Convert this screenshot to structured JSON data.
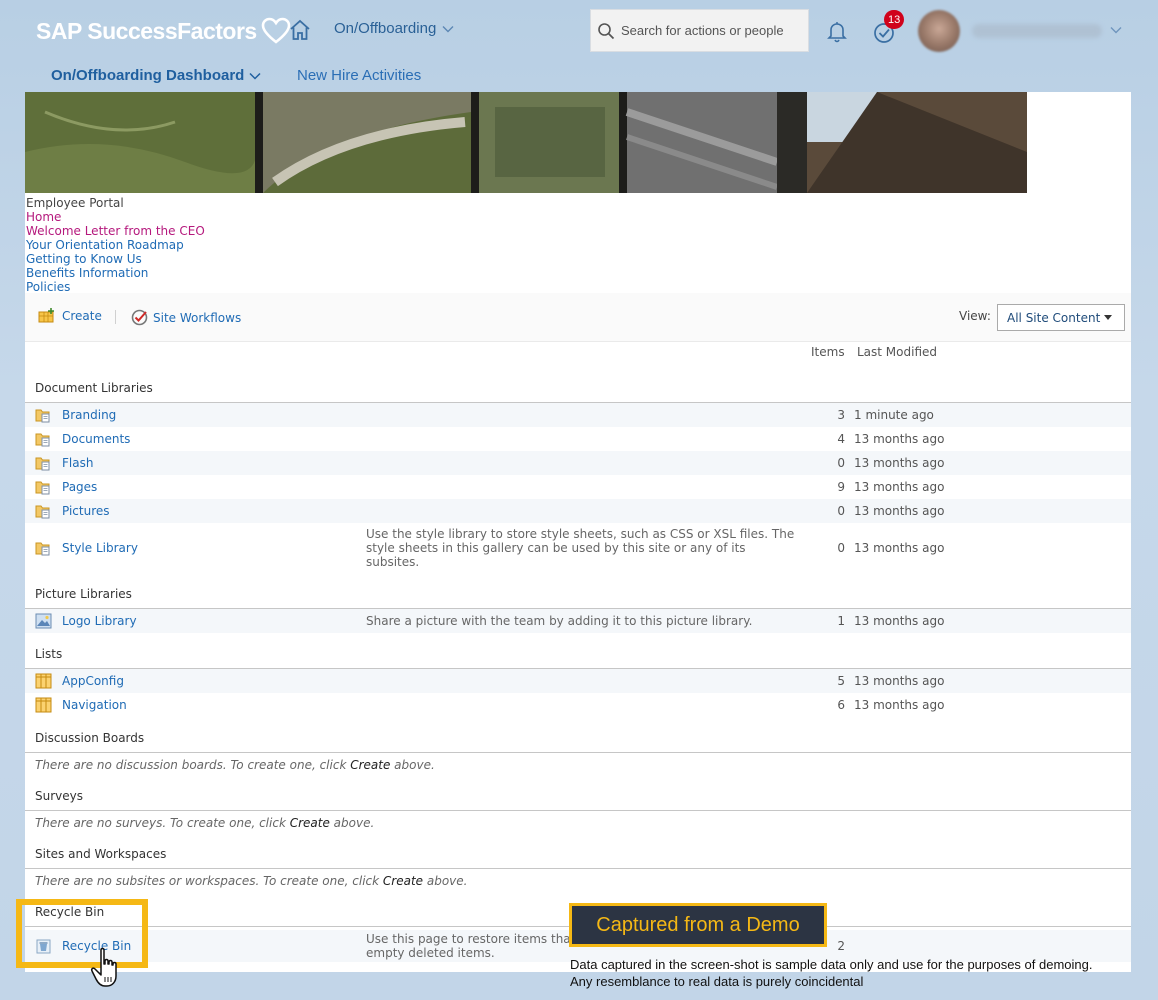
{
  "shell": {
    "brand": "SAP SuccessFactors",
    "module": "On/Offboarding",
    "search_placeholder": "Search for actions or people",
    "todo_badge": "13"
  },
  "subnav": {
    "dashboard": "On/Offboarding Dashboard",
    "new_hire": "New Hire Activities"
  },
  "portal_nav": {
    "heading": "Employee Portal",
    "links": [
      "Home",
      "Welcome Letter from the CEO",
      "Your Orientation Roadmap",
      "Getting to Know Us",
      "Benefits Information",
      "Policies"
    ]
  },
  "toolbar": {
    "create": "Create",
    "site_workflows": "Site Workflows",
    "view_label": "View:",
    "view_value": "All Site Content"
  },
  "columns": {
    "items": "Items",
    "last_modified": "Last Modified"
  },
  "sections": {
    "document_libraries": {
      "title": "Document Libraries",
      "rows": [
        {
          "name": "Branding",
          "desc": "",
          "items": "3",
          "modified": "1 minute ago"
        },
        {
          "name": "Documents",
          "desc": "",
          "items": "4",
          "modified": "13 months ago"
        },
        {
          "name": "Flash",
          "desc": "",
          "items": "0",
          "modified": "13 months ago"
        },
        {
          "name": "Pages",
          "desc": "",
          "items": "9",
          "modified": "13 months ago"
        },
        {
          "name": "Pictures",
          "desc": "",
          "items": "0",
          "modified": "13 months ago"
        },
        {
          "name": "Style Library",
          "desc_lines": [
            "Use the style library to store style sheets, such as CSS or XSL files. The",
            "style sheets in this gallery can be used by this site or any of its",
            "subsites."
          ],
          "items": "0",
          "modified": "13 months ago"
        }
      ]
    },
    "picture_libraries": {
      "title": "Picture Libraries",
      "rows": [
        {
          "name": "Logo Library",
          "desc": "Share a picture with the team by adding it to this picture library.",
          "items": "1",
          "modified": "13 months ago"
        }
      ]
    },
    "lists": {
      "title": "Lists",
      "rows": [
        {
          "name": "AppConfig",
          "items": "5",
          "modified": "13 months ago"
        },
        {
          "name": "Navigation",
          "items": "6",
          "modified": "13 months ago"
        }
      ]
    },
    "discussion_boards": {
      "title": "Discussion Boards",
      "empty_pre": "There are no discussion boards. To create one, click ",
      "empty_link": "Create",
      "empty_post": " above."
    },
    "surveys": {
      "title": "Surveys",
      "empty_pre": "There are no surveys. To create one, click ",
      "empty_link": "Create",
      "empty_post": " above."
    },
    "sites": {
      "title": "Sites and Workspaces",
      "empty_pre": "There are no subsites or workspaces. To create one, click ",
      "empty_link": "Create",
      "empty_post": " above."
    },
    "recycle_bin": {
      "title": "Recycle Bin",
      "name": "Recycle Bin",
      "desc_lines": [
        "Use this page to restore items tha",
        "empty deleted items."
      ],
      "items": "2"
    }
  },
  "overlay": {
    "demo_tag": "Captured from a Demo",
    "note_line1": "Data captured in the screen-shot is sample data only and use for the purposes of demoing.",
    "note_line2": "Any resemblance to real data is purely coincidental"
  },
  "colors": {
    "accent_blue": "#1f6bb5",
    "link_pink": "#b5197d",
    "highlight": "#f5b815",
    "badge_red": "#d0021b"
  }
}
